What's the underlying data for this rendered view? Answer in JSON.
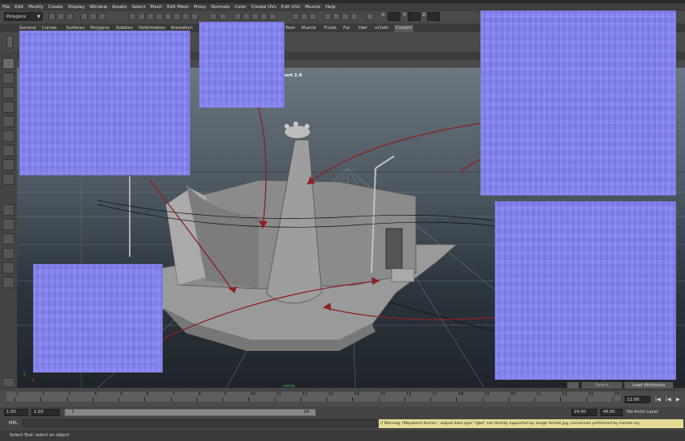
{
  "menubar": {
    "items": [
      "File",
      "Edit",
      "Modify",
      "Create",
      "Display",
      "Window",
      "Assets",
      "Select",
      "Mesh",
      "Edit Mesh",
      "Proxy",
      "Normals",
      "Color",
      "Create UVs",
      "Edit UVs",
      "Muscle",
      "Help"
    ]
  },
  "statusline": {
    "mode": "Polygons",
    "coord_labels": {
      "x": "X:",
      "y": "Y:",
      "z": "Z:"
    }
  },
  "shelf": {
    "tabs": [
      "General",
      "Curves",
      "Surfaces",
      "Polygons",
      "Subdivs",
      "Deformation",
      "Animation",
      "Toon",
      "Muscle",
      "Fluids",
      "Fur",
      "Hair",
      "nCloth",
      "Custom"
    ],
    "active_tab": "Custom"
  },
  "viewport": {
    "renderer_label": "port 2.0",
    "camera_label": "persp",
    "axis": {
      "x": "x",
      "y": "y"
    },
    "colors": {
      "normal_map": "#8181ef",
      "arrow": "#8b2222",
      "grid_accent": "#46b05a"
    }
  },
  "channel_box": {
    "select_label": "Select",
    "load_attributes_label": "Load Attributes"
  },
  "timeslider": {
    "ticks": [
      "1",
      "2",
      "3",
      "4",
      "5",
      "6",
      "7",
      "8",
      "9",
      "10",
      "11",
      "12",
      "13",
      "14",
      "15",
      "16",
      "17",
      "18",
      "19",
      "20",
      "21",
      "22",
      "23",
      "24"
    ],
    "current_frame": "12.00"
  },
  "rangeslider": {
    "start_time": "1.00",
    "playback_start": "1.00",
    "range_start": "1",
    "range_end": "24",
    "playback_end": "24.00",
    "end_time": "48.00",
    "anim_layer": "No Anim Layer"
  },
  "cmdline": {
    "label": "MEL",
    "warning": "// Warning: (Mayatomr.Scene) : output data type \"rgba\" not directly supported by image format jpg, conversion performed by mental ray"
  },
  "helpline": {
    "text": "Select Tool: select an object"
  }
}
